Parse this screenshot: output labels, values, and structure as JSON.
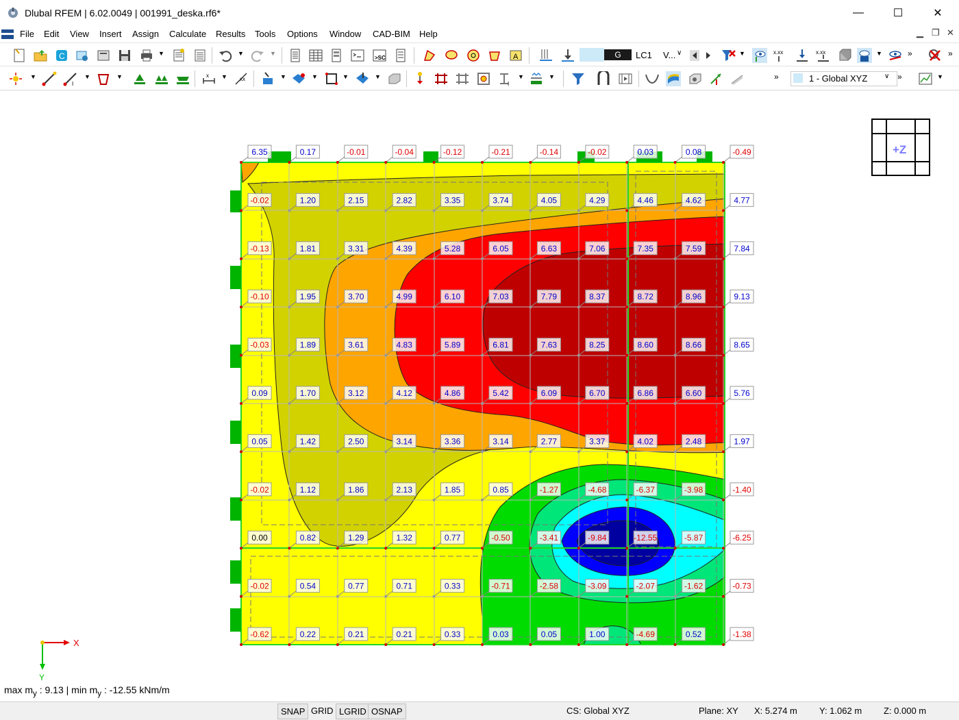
{
  "window": {
    "title": "Dlubal RFEM | 6.02.0049 | 001991_deska.rf6*",
    "minimize": "—",
    "maximize": "☐",
    "close": "✕"
  },
  "menu": [
    "File",
    "Edit",
    "View",
    "Insert",
    "Assign",
    "Calculate",
    "Results",
    "Tools",
    "Options",
    "Window",
    "CAD-BIM",
    "Help"
  ],
  "toolbar": {
    "load_case_type": "G",
    "load_case": "LC1",
    "view_mode": "V...",
    "coordinate_system": "1 - Global XYZ"
  },
  "view_cube_label": "+Z",
  "axes": {
    "x": "X",
    "y": "Y"
  },
  "result_info": {
    "max_label": "max m",
    "max_sub": "y",
    "max_value": " : 9.13 | min m",
    "min_sub": "y",
    "min_value": " : -12.55 kNm/m"
  },
  "status": {
    "snap": "SNAP",
    "grid": "GRID",
    "lgrid": "LGRID",
    "osnap": "OSNAP",
    "cs": "CS: Global XYZ",
    "plane": "Plane: XY",
    "x": "X: 5.274 m",
    "y": "Y: 1.062 m",
    "z": "Z: 0.000 m"
  },
  "colors": {
    "yellow": "#ffff00",
    "olive": "#d2d200",
    "orange": "#ffa500",
    "red": "#ff0000",
    "dark_red": "#be0000",
    "green": "#00dc00",
    "light_green": "#00e678",
    "cyan": "#00ffff",
    "blue": "#0000ff",
    "dark_blue": "#0000a0",
    "support_green": "#00b400",
    "positive_text": "#0000cc",
    "negative_text": "#e00000"
  },
  "result_values": [
    [
      "6.35",
      "0.17",
      "-0.01",
      "-0.04",
      "-0.12",
      "-0.21",
      "-0.14",
      "-0.02",
      "0.03",
      "0.08",
      "-0.49"
    ],
    [
      "-0.02",
      "1.20",
      "2.15",
      "2.82",
      "3.35",
      "3.74",
      "4.05",
      "4.29",
      "4.46",
      "4.62",
      "4.77"
    ],
    [
      "-0.13",
      "1.81",
      "3.31",
      "4.39",
      "5.28",
      "6.05",
      "6.63",
      "7.06",
      "7.35",
      "7.59",
      "7.84"
    ],
    [
      "-0.10",
      "1.95",
      "3.70",
      "4.99",
      "6.10",
      "7.03",
      "7.79",
      "8.37",
      "8.72",
      "8.96",
      "9.13"
    ],
    [
      "-0.03",
      "1.89",
      "3.61",
      "4.83",
      "5.89",
      "6.81",
      "7.63",
      "8.25",
      "8.60",
      "8.66",
      "8.65"
    ],
    [
      "0.09",
      "1.70",
      "3.12",
      "4.12",
      "4.86",
      "5.42",
      "6.09",
      "6.70",
      "6.86",
      "6.60",
      "5.76"
    ],
    [
      "0.05",
      "1.42",
      "2.50",
      "3.14",
      "3.36",
      "3.14",
      "2.77",
      "3.37",
      "4.02",
      "2.48",
      "1.97"
    ],
    [
      "-0.02",
      "1.12",
      "1.86",
      "2.13",
      "1.85",
      "0.85",
      "-1.27",
      "-4.68",
      "-6.37",
      "-3.98",
      "-1.40"
    ],
    [
      "0.00",
      "0.82",
      "1.29",
      "1.32",
      "0.77",
      "-0.50",
      "-3.41",
      "-9.84",
      "-12.55",
      "-5.87",
      "-6.25"
    ],
    [
      "-0.02",
      "0.54",
      "0.77",
      "0.71",
      "0.33",
      "-0.71",
      "-2.58",
      "-3.09",
      "-2.07",
      "-1.62",
      "-0.73"
    ],
    [
      "-0.62",
      "0.22",
      "0.21",
      "0.21",
      "0.33",
      "0.03",
      "0.05",
      "1.00",
      "-4.69",
      "0.52",
      "-1.38"
    ]
  ]
}
